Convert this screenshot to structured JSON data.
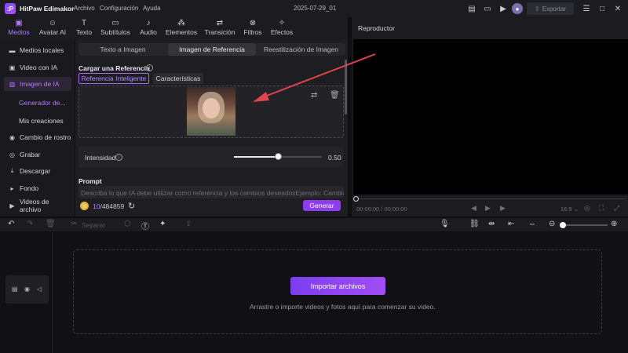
{
  "app": {
    "name": "HitPaw Edimakor",
    "menus": [
      "Archivo",
      "Configuración",
      "Ayuda"
    ],
    "project_name": "2025-07-29_01",
    "export_label": "Exportar"
  },
  "toolbar": {
    "tabs": [
      {
        "label": "Medios",
        "icon": "media-icon"
      },
      {
        "label": "Avatar AI",
        "icon": "avatar-icon"
      },
      {
        "label": "Texto",
        "icon": "text-icon"
      },
      {
        "label": "Subtítulos",
        "icon": "subtitles-icon"
      },
      {
        "label": "Audio",
        "icon": "music-icon"
      },
      {
        "label": "Elementos",
        "icon": "elements-icon"
      },
      {
        "label": "Transición",
        "icon": "transition-icon"
      },
      {
        "label": "Filtros",
        "icon": "filters-icon"
      },
      {
        "label": "Efectos",
        "icon": "effects-icon"
      }
    ],
    "active": "Medios"
  },
  "sidebar": {
    "items": [
      {
        "label": "Medios locales",
        "icon": "folder-icon"
      },
      {
        "label": "Video con IA",
        "icon": "ai-video-icon"
      },
      {
        "label": "Imagen de IA",
        "icon": "ai-image-icon"
      },
      {
        "label": "Cambio de rostro",
        "icon": "face-swap-icon"
      },
      {
        "label": "Grabar",
        "icon": "record-icon"
      },
      {
        "label": "Descargar",
        "icon": "download-icon"
      },
      {
        "label": "Fondo",
        "icon": "background-icon"
      },
      {
        "label": "Videos de archivo",
        "icon": "stock-video-icon"
      }
    ],
    "subitems": [
      "Generador de...",
      "Mis creaciones"
    ],
    "active_item": "Imagen de IA",
    "active_subitem": "Generador de..."
  },
  "main": {
    "mode_tabs": [
      "Texto a Imagen",
      "Imagen de Referencia",
      "Reestilización de Imagen"
    ],
    "active_mode": "Imagen de Referencia",
    "upload_title": "Cargar una Referencia",
    "ref_chips": [
      "Referencia Inteligente",
      "Características"
    ],
    "active_chip": "Referencia Inteligente",
    "intensity_label": "Intensidad",
    "intensity_value": "0.50",
    "intensity_fraction": 0.5,
    "prompt_title": "Prompt",
    "prompt_placeholder": "Describa lo que IA debe utilizar como referencia y los cambios deseadosEjemplo: Cambiar el",
    "credits_used": "10",
    "credits_total": "/484859",
    "generate_label": "Generar"
  },
  "player": {
    "title": "Reproductor",
    "time": "00:00:00 / 00:00:00",
    "aspect": "16:9",
    "progress": 0
  },
  "timeline": {
    "split_label": "Separar",
    "import_label": "Importar archivos",
    "import_hint": "Arrastre o importe videos y fotos aquí para comenzar su video."
  },
  "colors": {
    "accent": "#b07cff",
    "primary_button": "#8c3df0",
    "annotation_arrow": "#e0454f"
  }
}
